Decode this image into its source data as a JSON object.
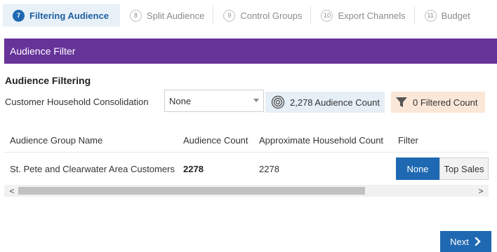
{
  "wizard": {
    "steps": [
      {
        "number": "7",
        "label": "Filtering Audience"
      },
      {
        "number": "8",
        "label": "Split Audience"
      },
      {
        "number": "9",
        "label": "Control Groups"
      },
      {
        "number": "10",
        "label": "Export Channels"
      },
      {
        "number": "11",
        "label": "Budget"
      }
    ]
  },
  "panel": {
    "title": "Audience Filter"
  },
  "filtering": {
    "section_title": "Audience Filtering",
    "household_label": "Customer Household Consolidation",
    "household_value": "None",
    "audience_count": "2,278 Audience Count",
    "filtered_count": "0 Filtered Count"
  },
  "table": {
    "headers": [
      "Audience Group Name",
      "Audience Count",
      "Approximate Household Count",
      "Filter"
    ],
    "rows": [
      {
        "name": "St. Pete and Clearwater Area Customers",
        "audience_count": "2278",
        "household_count": "2278",
        "filter_options": [
          "None",
          "Top Sales"
        ],
        "selected_filter": "None"
      }
    ]
  },
  "scrollbar": {
    "left_arrow": "<",
    "right_arrow": ">"
  },
  "footer": {
    "next_label": "Next"
  },
  "icons": {
    "audience_count": "target-icon",
    "filtered_count": "funnel-icon",
    "next": "chevron-right-icon",
    "select": "caret-down-icon"
  },
  "colors": {
    "primary": "#1f69b2",
    "panel_header": "#663399",
    "audience_badge": "#e6eff6",
    "filtered_badge": "#fbe7d8"
  }
}
